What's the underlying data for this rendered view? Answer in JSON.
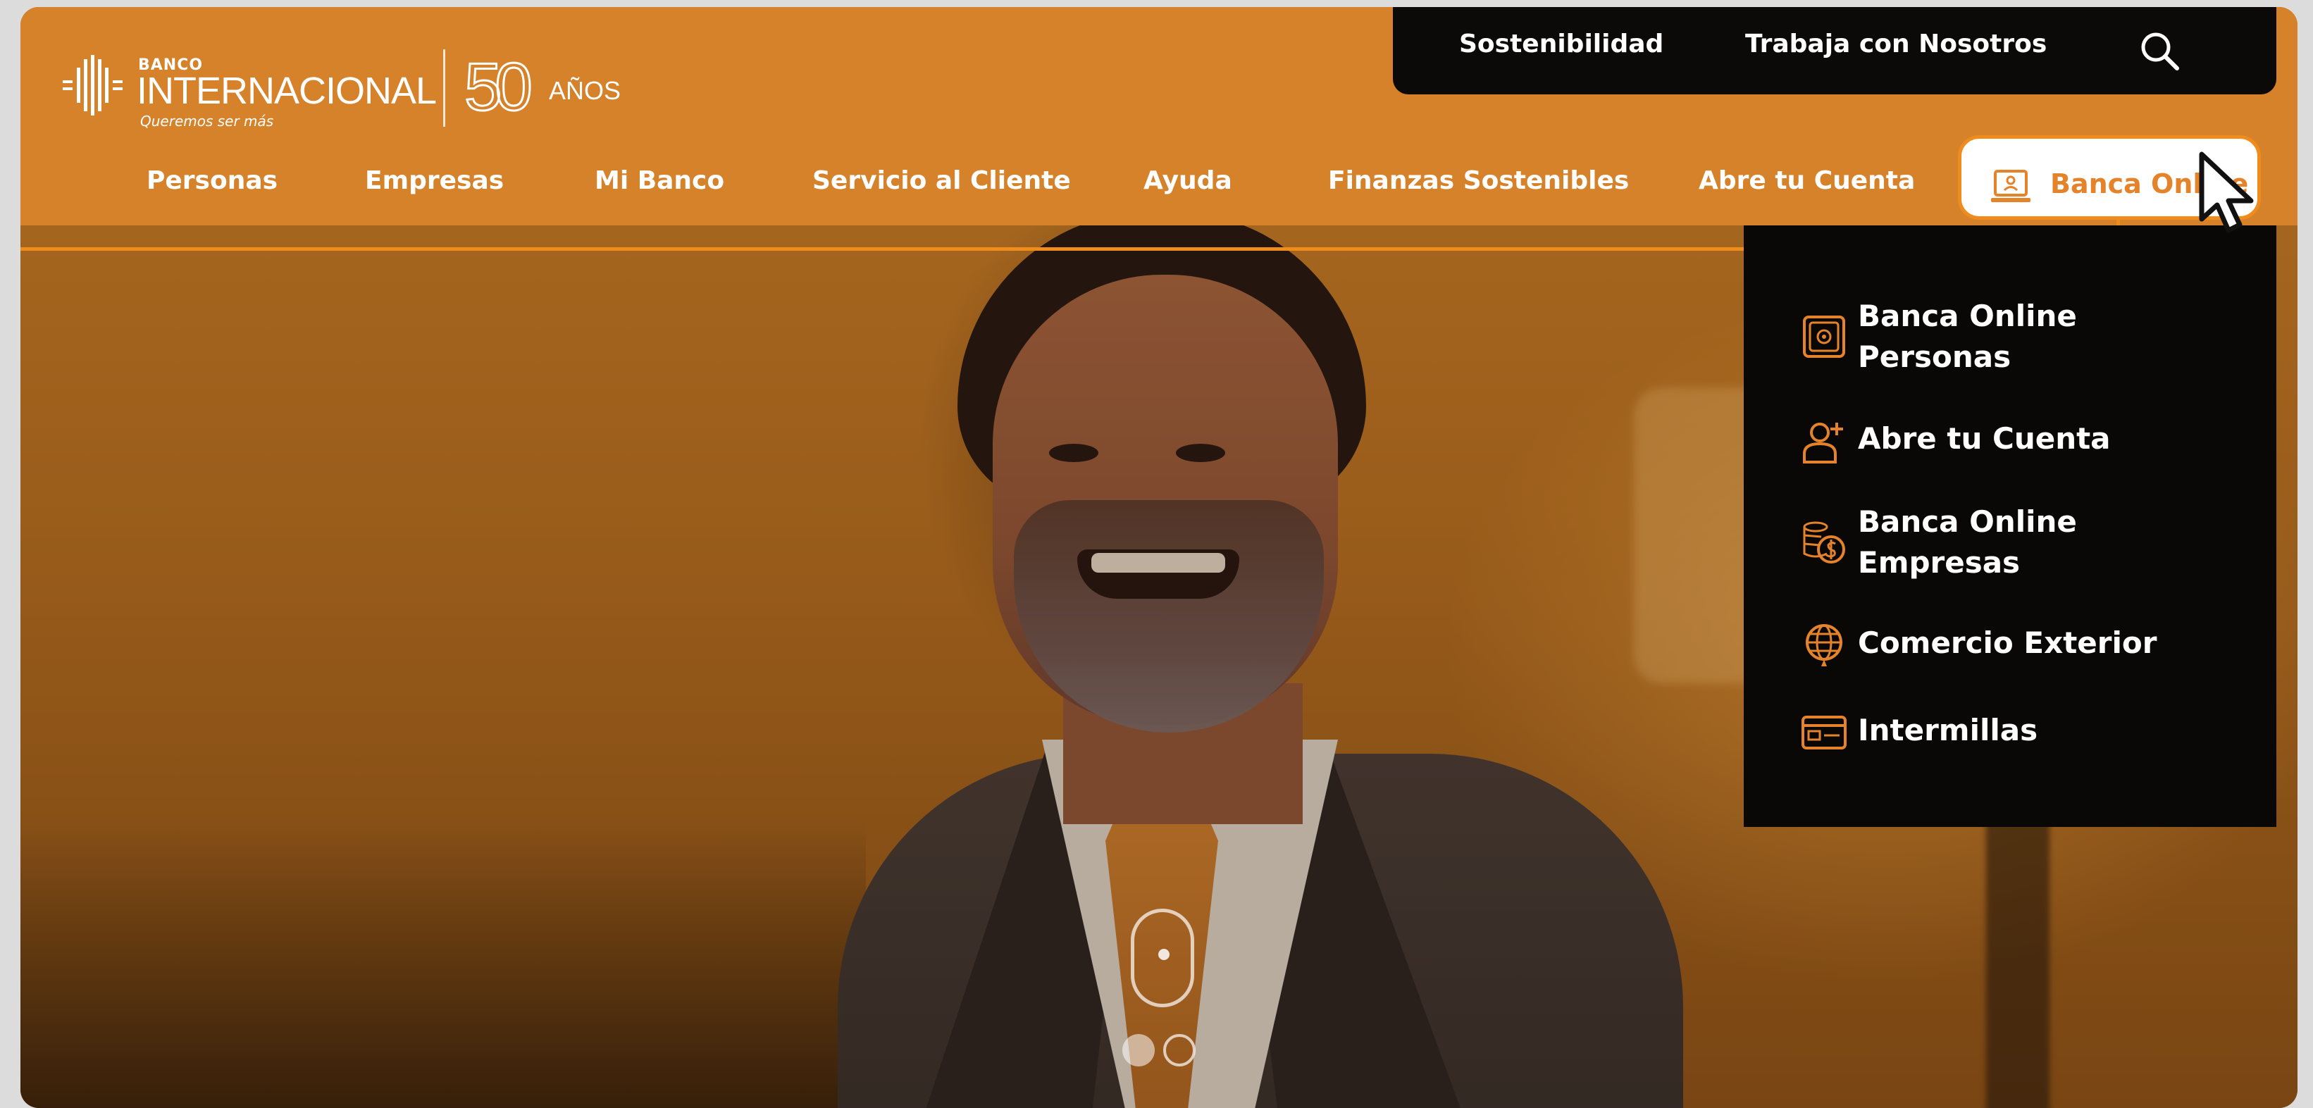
{
  "brand": {
    "banco": "BANCO",
    "name": "INTERNACIONAL",
    "tagline": "Queremos ser más",
    "anniversary_number": "50",
    "anniversary_word": "AÑOS"
  },
  "utility": {
    "links": [
      "Sostenibilidad",
      "Trabaja con Nosotros"
    ],
    "search_icon": "search-icon"
  },
  "nav": {
    "items": [
      "Personas",
      "Empresas",
      "Mi Banco",
      "Servicio al Cliente",
      "Ayuda",
      "Finanzas Sostenibles",
      "Abre tu Cuenta"
    ],
    "online_button": "Banca Online"
  },
  "dropdown": {
    "items": [
      {
        "label_line1": "Banca Online",
        "label_line2": "Personas",
        "icon": "safe-icon"
      },
      {
        "label_line1": "Abre tu Cuenta",
        "label_line2": "",
        "icon": "add-user-icon"
      },
      {
        "label_line1": "Banca Online",
        "label_line2": "Empresas",
        "icon": "coins-icon"
      },
      {
        "label_line1": "Comercio Exterior",
        "label_line2": "",
        "icon": "globe-icon"
      },
      {
        "label_line1": "Intermillas",
        "label_line2": "",
        "icon": "card-icon"
      }
    ]
  },
  "colors": {
    "brand_orange": "#d6822a",
    "accent_orange": "#f08c1c",
    "dark": "#0c0a09"
  },
  "carousel": {
    "slides": 2,
    "active_slide": 1
  }
}
